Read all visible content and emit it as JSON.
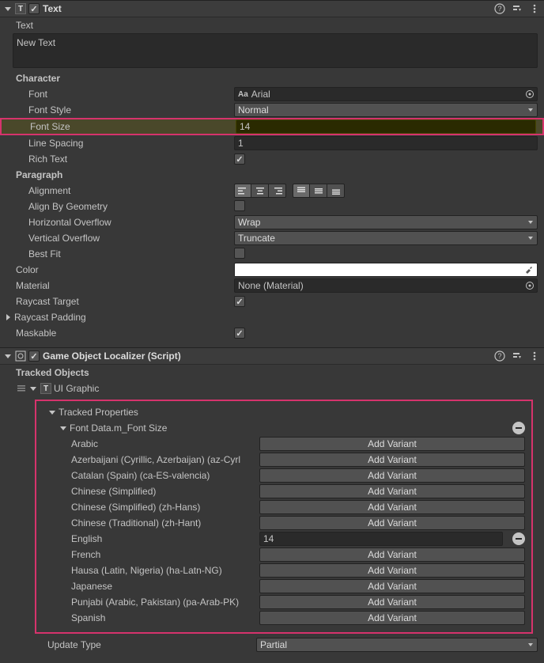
{
  "text_component": {
    "title": "Text",
    "text_label": "Text",
    "text_value": "New Text",
    "character_section": "Character",
    "font_label": "Font",
    "font_value": "Arial",
    "font_prefix": "Aa",
    "font_style_label": "Font Style",
    "font_style_value": "Normal",
    "font_size_label": "Font Size",
    "font_size_value": "14",
    "line_spacing_label": "Line Spacing",
    "line_spacing_value": "1",
    "rich_text_label": "Rich Text",
    "paragraph_section": "Paragraph",
    "alignment_label": "Alignment",
    "align_by_geometry_label": "Align By Geometry",
    "horizontal_overflow_label": "Horizontal Overflow",
    "horizontal_overflow_value": "Wrap",
    "vertical_overflow_label": "Vertical Overflow",
    "vertical_overflow_value": "Truncate",
    "best_fit_label": "Best Fit",
    "color_label": "Color",
    "material_label": "Material",
    "material_value": "None (Material)",
    "raycast_target_label": "Raycast Target",
    "raycast_padding_label": "Raycast Padding",
    "maskable_label": "Maskable"
  },
  "localizer": {
    "title": "Game Object Localizer (Script)",
    "tracked_objects_label": "Tracked Objects",
    "ui_graphic_label": "UI Graphic",
    "tracked_properties_label": "Tracked Properties",
    "font_size_property_label": "Font Data.m_Font Size",
    "add_variant_label": "Add Variant",
    "english_value": "14",
    "update_type_label": "Update Type",
    "update_type_value": "Partial",
    "locales": [
      "Arabic",
      "Azerbaijani (Cyrillic, Azerbaijan) (az-Cyrl",
      "Catalan (Spain) (ca-ES-valencia)",
      "Chinese (Simplified)",
      "Chinese (Simplified) (zh-Hans)",
      "Chinese (Traditional) (zh-Hant)",
      "English",
      "French",
      "Hausa (Latin, Nigeria) (ha-Latn-NG)",
      "Japanese",
      "Punjabi (Arabic, Pakistan) (pa-Arab-PK)",
      "Spanish"
    ]
  }
}
